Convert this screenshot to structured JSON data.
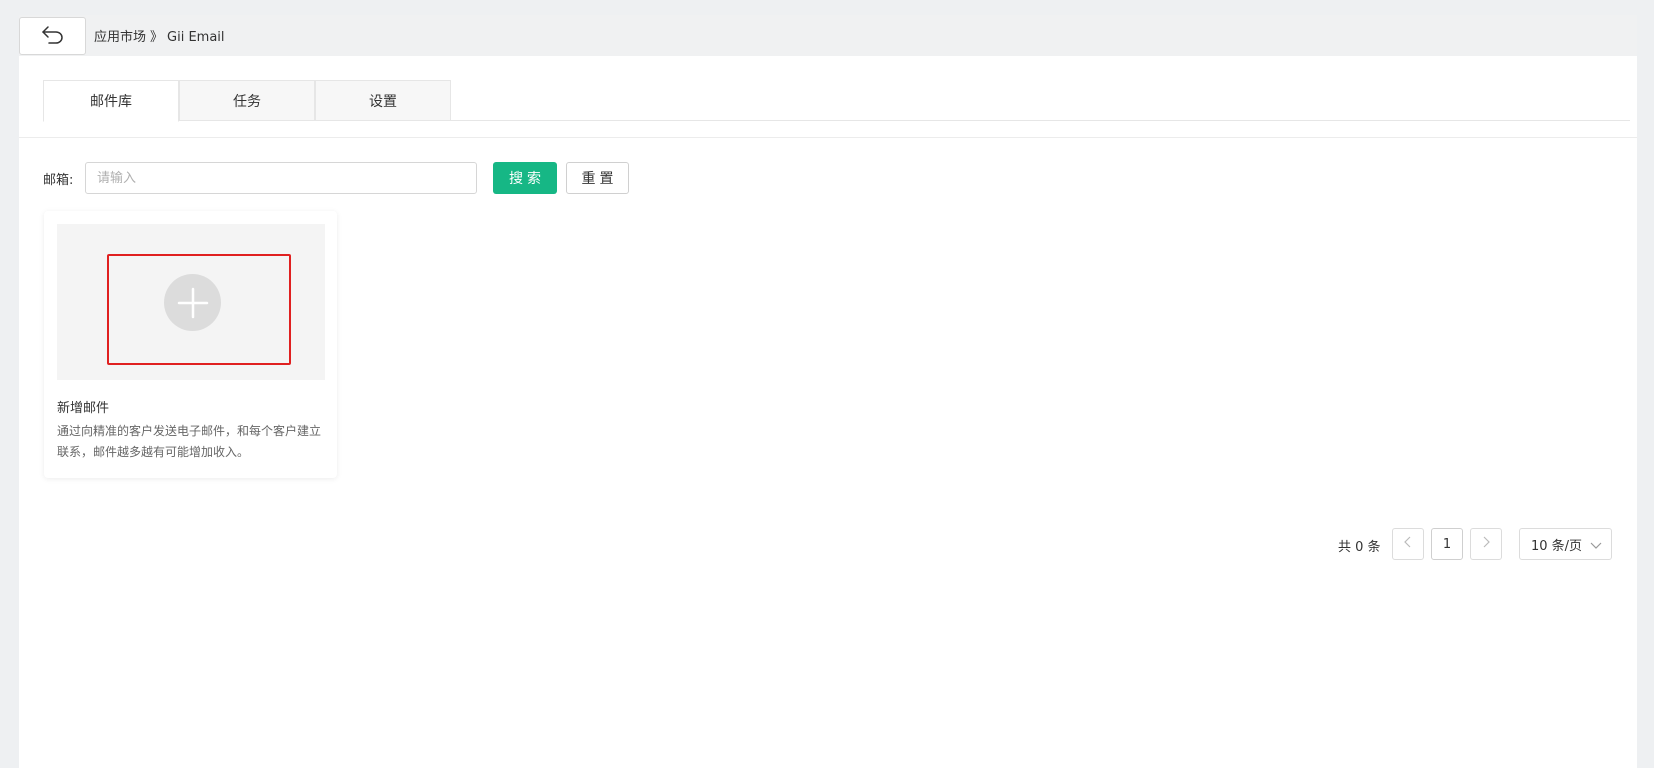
{
  "header": {
    "breadcrumb_root": "应用市场",
    "breadcrumb_sep": "》",
    "breadcrumb_current": "Gii Email"
  },
  "tabs": [
    {
      "label": "邮件库",
      "active": true
    },
    {
      "label": "任务",
      "active": false
    },
    {
      "label": "设置",
      "active": false
    }
  ],
  "filter": {
    "email_label": "邮箱:",
    "email_placeholder": "请输入",
    "email_value": "",
    "search_label": "搜索",
    "reset_label": "重置"
  },
  "card": {
    "title": "新增邮件",
    "description": "通过向精准的客户发送电子邮件，和每个客户建立联系，邮件越多越有可能增加收入。",
    "icon": "plus-icon"
  },
  "pagination": {
    "total_text": "共 0 条",
    "current_page": "1",
    "page_size": "10 条/页"
  },
  "colors": {
    "primary": "#16b785",
    "highlight": "#e02020"
  }
}
